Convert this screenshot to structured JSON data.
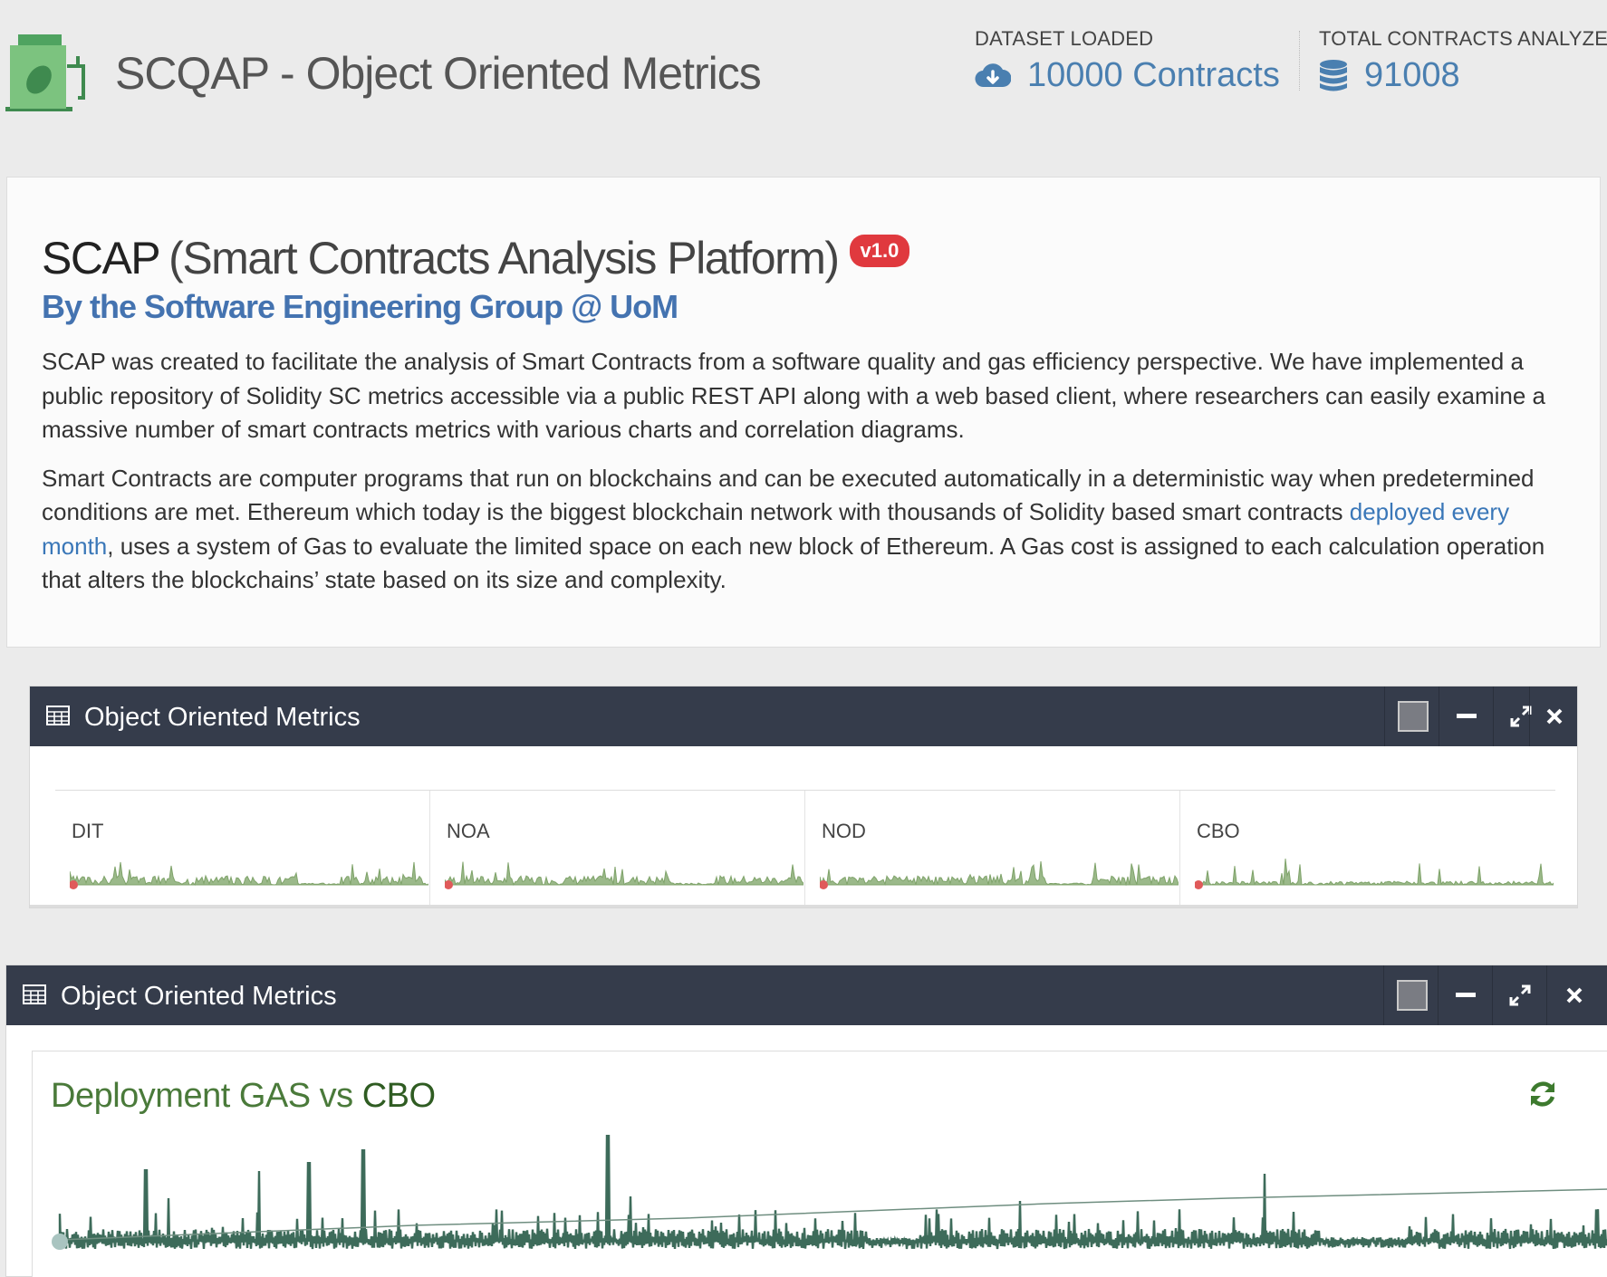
{
  "header": {
    "app_title": "SCQAP - Object Oriented Metrics",
    "logo_icon": "gas-pump-leaf-icon",
    "dataset": {
      "label": "DATASET LOADED",
      "value": "10000 Contracts",
      "icon": "cloud-download-icon"
    },
    "total": {
      "label": "TOTAL CONTRACTS ANALYZED",
      "value": "91008",
      "icon": "database-icon"
    }
  },
  "intro": {
    "title_bold": "SCAP",
    "title_rest": "(Smart Contracts Analysis Platform)",
    "version": "v1.0",
    "subtitle": "By the Software Engineering Group @ UoM",
    "paragraph1": "SCAP was created to facilitate the analysis of Smart Contracts from a software quality and gas efficiency perspective. We have implemented a public repository of Solidity SC metrics accessible via a public REST API along with a web based client, where researchers can easily examine a massive number of smart contracts metrics with various charts and correlation diagrams.",
    "paragraph2_before": "Smart Contracts are computer programs that run on blockchains and can be executed automatically in a deterministic way when predetermined conditions are met. Ethereum which today is the biggest blockchain network with thousands of Solidity based smart contracts ",
    "paragraph2_link": "deployed every month",
    "paragraph2_after": ", uses a system of Gas to evaluate the limited space on each new block of Ethereum. A Gas cost is assigned to each calculation operation that alters the blockchains’ state based on its size and complexity."
  },
  "widget_metrics": {
    "title": "Object Oriented Metrics",
    "sparklines": [
      {
        "label": "DIT"
      },
      {
        "label": "NOA"
      },
      {
        "label": "NOD"
      },
      {
        "label": "CBO"
      }
    ]
  },
  "widget_chart": {
    "title": "Object Oriented Metrics",
    "chart_title_prefix": "Deployment GAS vs",
    "chart_title_emph": "CBO"
  },
  "chart_data": {
    "type": "line",
    "title": "Deployment GAS vs CBO",
    "series": [],
    "grid": false
  },
  "colors": {
    "header_bar": "#353c4b",
    "spark_green": "#7fa36a",
    "chart_green": "#3d6b5a",
    "badge_red": "#e0393e",
    "link_blue": "#3a77b8"
  }
}
